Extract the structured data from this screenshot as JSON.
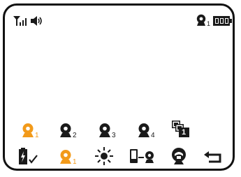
{
  "colors": {
    "accent": "#F29A1A",
    "icon": "#1A1A1A",
    "background": "#FFFFFF",
    "frame": "#111111"
  },
  "status_bar": {
    "signal": {
      "icon": "signal-antenna-icon"
    },
    "speaker": {
      "icon": "speaker-volume-icon"
    },
    "camera_indicator": {
      "icon": "camera-icon",
      "number": "1"
    },
    "battery": {
      "icon": "battery-icon",
      "level": 1.0
    }
  },
  "camera_row": [
    {
      "icon": "camera-icon",
      "number": "1",
      "selected": true
    },
    {
      "icon": "camera-icon",
      "number": "2",
      "selected": false
    },
    {
      "icon": "camera-icon",
      "number": "3",
      "selected": false
    },
    {
      "icon": "camera-icon",
      "number": "4",
      "selected": false
    },
    {
      "icon": "multi-camera-scan-icon",
      "number": "1",
      "selected": false
    }
  ],
  "bottom_row": [
    {
      "icon": "battery-charge-check-icon"
    },
    {
      "icon": "camera-icon",
      "number": "1",
      "selected": true
    },
    {
      "icon": "brightness-icon"
    },
    {
      "icon": "pair-camera-icon"
    },
    {
      "icon": "headset-talk-icon"
    },
    {
      "icon": "back-return-icon"
    }
  ]
}
